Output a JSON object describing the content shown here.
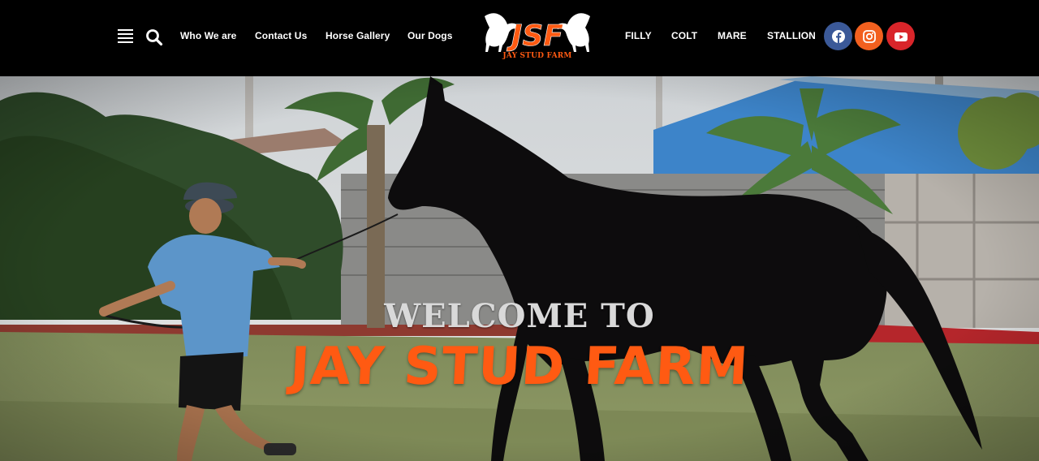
{
  "header": {
    "nav_left": [
      "Who We are",
      "Contact Us",
      "Horse Gallery",
      "Our Dogs"
    ],
    "nav_right": [
      "FILLY",
      "COLT",
      "MARE",
      "STALLION"
    ],
    "logo": {
      "letters": "JSF",
      "subtitle": "JAY STUD FARM"
    },
    "icons": [
      "menu-icon",
      "search-icon"
    ],
    "social": [
      {
        "name": "facebook-icon",
        "color": "#3b5998"
      },
      {
        "name": "instagram-icon",
        "color": "#f2601f"
      },
      {
        "name": "youtube-icon",
        "color": "#d9252a"
      }
    ]
  },
  "hero": {
    "welcome": "WELCOME TO",
    "brand": "JAY STUD FARM",
    "colors": {
      "brand": "#ff5a12",
      "welcome": "#d9d9d9"
    }
  }
}
